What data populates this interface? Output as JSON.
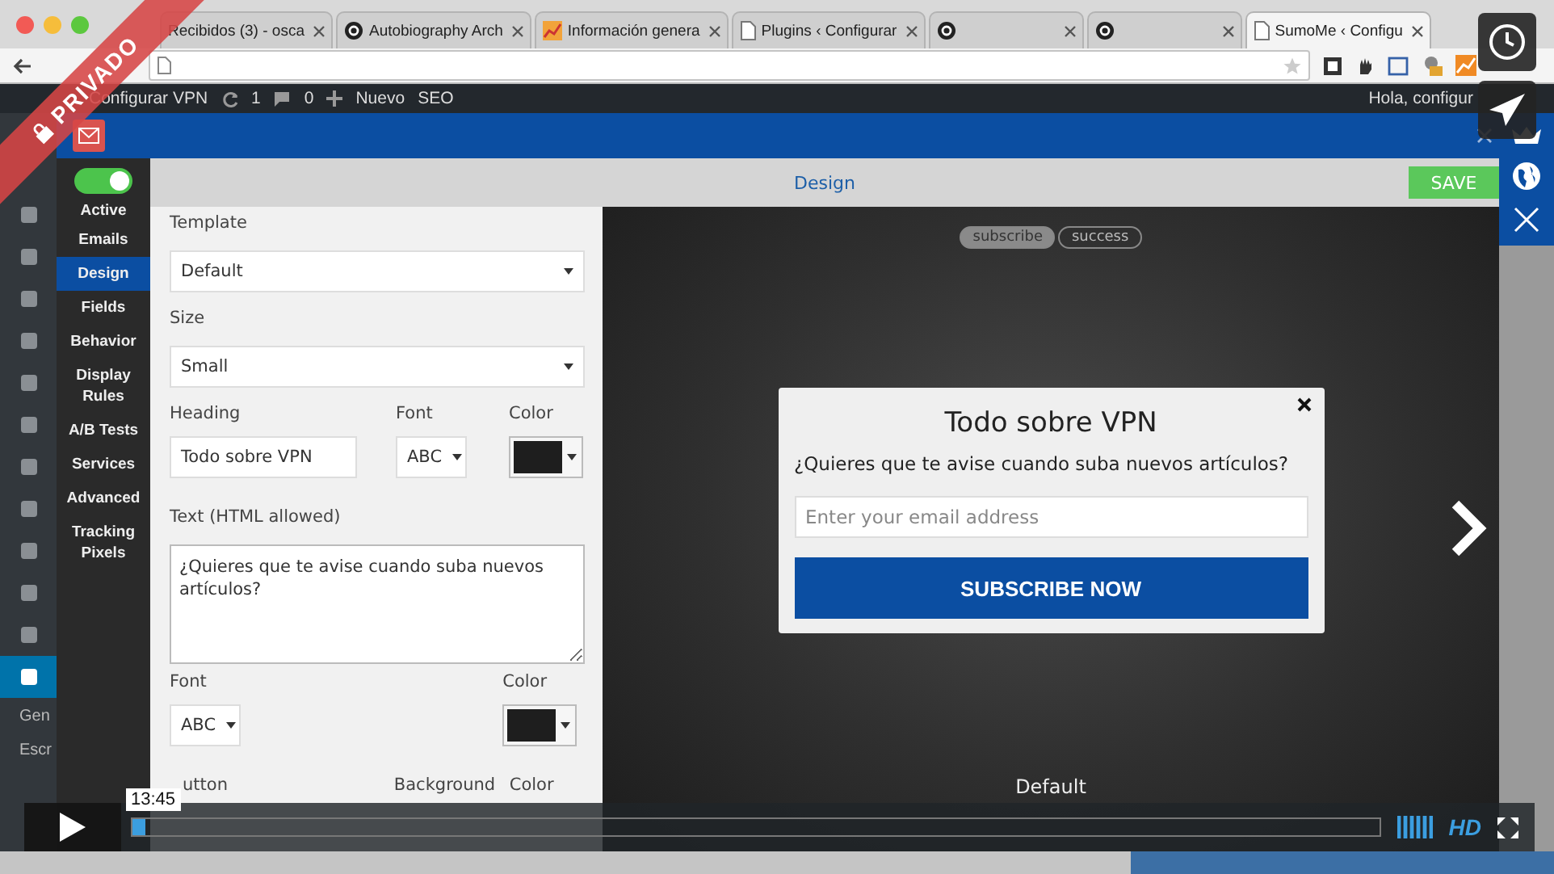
{
  "browser": {
    "tabs": [
      {
        "title": "Recibidos (3) - osca",
        "selected": false
      },
      {
        "title": "Autobiography Arch",
        "kind": "circle",
        "selected": false
      },
      {
        "title": "Información genera",
        "kind": "chart",
        "selected": false
      },
      {
        "title": "Plugins ‹ Configurar",
        "kind": "page",
        "selected": false
      },
      {
        "kind": "circle",
        "selected": false
      },
      {
        "kind": "circle",
        "selected": false
      },
      {
        "title": "SumoMe ‹ Configu",
        "kind": "page",
        "selected": true
      }
    ]
  },
  "wp_admin_bar": {
    "site": "Configurar VPN",
    "updates": "1",
    "comments": "0",
    "new": "Nuevo",
    "seo": "SEO",
    "greeting": "Hola, configur"
  },
  "wp_sidebar": {
    "menu": [
      {
        "selected": false
      },
      {
        "selected": false
      },
      {
        "selected": false
      },
      {
        "selected": false
      },
      {
        "selected": false
      },
      {
        "selected": false
      },
      {
        "selected": false
      },
      {
        "selected": false
      },
      {
        "selected": false
      },
      {
        "selected": false
      },
      {
        "selected": false
      },
      {
        "selected": true
      }
    ],
    "submenu": [
      "Gen",
      "Escr"
    ]
  },
  "modal": {
    "nav": {
      "toggle": {
        "on": true,
        "label": "Active"
      },
      "items": [
        {
          "label": "Emails",
          "selected": false
        },
        {
          "label": "Design",
          "selected": true
        },
        {
          "label": "Fields",
          "selected": false
        },
        {
          "label": "Behavior",
          "selected": false
        },
        {
          "label": "Display Rules",
          "selected": false
        },
        {
          "label": "A/B Tests",
          "selected": false
        },
        {
          "label": "Services",
          "selected": false
        },
        {
          "label": "Advanced",
          "selected": false
        },
        {
          "label": "Tracking Pixels",
          "selected": false
        }
      ]
    },
    "header": {
      "title": "Design",
      "save": "SAVE"
    },
    "form": {
      "template": {
        "label": "Template",
        "value": "Default"
      },
      "size": {
        "label": "Size",
        "value": "Small"
      },
      "heading": {
        "label": "Heading",
        "value": "Todo sobre VPN",
        "font_label": "Font",
        "font": "ABC",
        "color_label": "Color",
        "color": "#1e1e1e"
      },
      "text": {
        "label": "Text (HTML allowed)",
        "value": "¿Quieres que te avise cuando suba nuevos artículos?",
        "font_label": "Font",
        "font": "ABC",
        "color_label": "Color",
        "color": "#1e1e1e"
      },
      "button": {
        "label": "utton",
        "background_label": "Background",
        "color_label": "Color"
      }
    },
    "preview": {
      "tabs": [
        {
          "label": "subscribe",
          "selected": true
        },
        {
          "label": "success",
          "selected": false
        }
      ],
      "popup": {
        "title": "Todo sobre VPN",
        "text": "¿Quieres que te avise cuando suba nuevos artículos?",
        "email_placeholder": "Enter your email address",
        "button": "SUBSCRIBE NOW"
      },
      "template_name": "Default"
    }
  },
  "player": {
    "ribbon": "PRIVADO",
    "time": "13:45",
    "progress": {
      "level": 0.01
    },
    "quality": "HD"
  }
}
